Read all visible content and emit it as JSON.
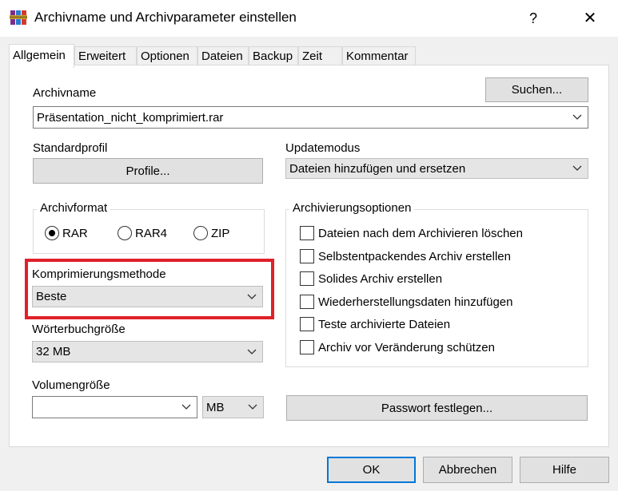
{
  "window": {
    "title": "Archivname und Archivparameter einstellen",
    "help_glyph": "?",
    "close_glyph": "✕"
  },
  "tabs": [
    {
      "label": "Allgemein",
      "active": true
    },
    {
      "label": "Erweitert"
    },
    {
      "label": "Optionen"
    },
    {
      "label": "Dateien"
    },
    {
      "label": "Backup"
    },
    {
      "label": "Zeit"
    },
    {
      "label": "Kommentar"
    }
  ],
  "general": {
    "archive_name_label": "Archivname",
    "browse_button": "Suchen...",
    "archive_name_value": "Präsentation_nicht_komprimiert.rar",
    "default_profile_label": "Standardprofil",
    "profiles_button": "Profile...",
    "update_mode_label": "Updatemodus",
    "update_mode_value": "Dateien hinzufügen und ersetzen",
    "archive_format": {
      "title": "Archivformat",
      "options": [
        {
          "label": "RAR",
          "checked": true
        },
        {
          "label": "RAR4",
          "checked": false
        },
        {
          "label": "ZIP",
          "checked": false
        }
      ]
    },
    "compression_method_label": "Komprimierungsmethode",
    "compression_method_value": "Beste",
    "dictionary_size_label": "Wörterbuchgröße",
    "dictionary_size_value": "32 MB",
    "volume_size_label": "Volumengröße",
    "volume_size_value": "",
    "volume_unit_value": "MB",
    "archiving_options": {
      "title": "Archivierungsoptionen",
      "options": [
        {
          "label": "Dateien nach dem Archivieren löschen",
          "checked": false
        },
        {
          "label": "Selbstentpackendes Archiv erstellen",
          "checked": false
        },
        {
          "label": "Solides Archiv erstellen",
          "checked": false
        },
        {
          "label": "Wiederherstellungsdaten hinzufügen",
          "checked": false
        },
        {
          "label": "Teste archivierte Dateien",
          "checked": false
        },
        {
          "label": "Archiv vor Veränderung schützen",
          "checked": false
        }
      ]
    },
    "set_password_button": "Passwort festlegen..."
  },
  "footer": {
    "ok": "OK",
    "cancel": "Abbrechen",
    "help": "Hilfe"
  },
  "colors": {
    "highlight_frame": "#e0202a",
    "default_button_border": "#0078d7"
  },
  "icons": {
    "app": "winrar-books-icon",
    "chevron": "chevron-down-icon"
  }
}
